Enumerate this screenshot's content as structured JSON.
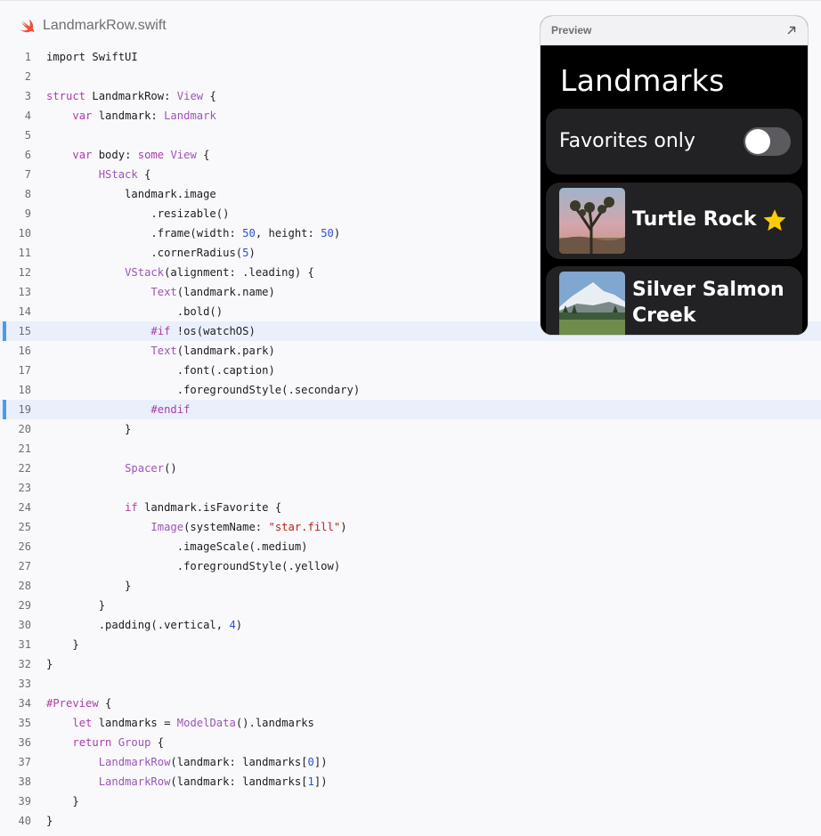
{
  "file": {
    "name": "LandmarkRow.swift",
    "icon": "swift-icon",
    "accent": "#f05138"
  },
  "preview": {
    "label": "Preview",
    "expand_icon": "expand-arrow-icon",
    "title": "Landmarks",
    "toggle_label": "Favorites only",
    "toggle_on": false,
    "rows": [
      {
        "name": "Turtle Rock",
        "favorite": true,
        "image": "joshua-tree-photo"
      },
      {
        "name": "Silver Salmon Creek",
        "name_lines": [
          "Silver Salmon",
          "Creek"
        ],
        "favorite": false,
        "image": "mountain-lake-photo"
      }
    ]
  },
  "highlighted_lines": [
    15,
    19
  ],
  "colors": {
    "highlight_bg": "#e9f0fb",
    "highlight_bar": "#4c9be8",
    "keyword": "#ad3da4",
    "type": "#9d54b8",
    "number": "#2a4fd6",
    "string": "#c41a16"
  },
  "code_lines": [
    [
      [
        "import SwiftUI",
        "p"
      ]
    ],
    [],
    [
      [
        "struct ",
        "k"
      ],
      [
        "LandmarkRow: ",
        "p"
      ],
      [
        "View",
        "t"
      ],
      [
        " {",
        "p"
      ]
    ],
    [
      [
        "    ",
        "p"
      ],
      [
        "var ",
        "k"
      ],
      [
        "landmark: ",
        "p"
      ],
      [
        "Landmark",
        "t"
      ]
    ],
    [],
    [
      [
        "    ",
        "p"
      ],
      [
        "var ",
        "k"
      ],
      [
        "body: ",
        "p"
      ],
      [
        "some ",
        "k"
      ],
      [
        "View",
        "t"
      ],
      [
        " {",
        "p"
      ]
    ],
    [
      [
        "        ",
        "p"
      ],
      [
        "HStack",
        "t"
      ],
      [
        " {",
        "p"
      ]
    ],
    [
      [
        "            landmark.image",
        "p"
      ]
    ],
    [
      [
        "                .resizable()",
        "p"
      ]
    ],
    [
      [
        "                .frame(width: ",
        "p"
      ],
      [
        "50",
        "n"
      ],
      [
        ", height: ",
        "p"
      ],
      [
        "50",
        "n"
      ],
      [
        ")",
        "p"
      ]
    ],
    [
      [
        "                .cornerRadius(",
        "p"
      ],
      [
        "5",
        "n"
      ],
      [
        ")",
        "p"
      ]
    ],
    [
      [
        "            ",
        "p"
      ],
      [
        "VStack",
        "t"
      ],
      [
        "(alignment: .leading) {",
        "p"
      ]
    ],
    [
      [
        "                ",
        "p"
      ],
      [
        "Text",
        "t"
      ],
      [
        "(landmark.name)",
        "p"
      ]
    ],
    [
      [
        "                    .bold()",
        "p"
      ]
    ],
    [
      [
        "                ",
        "p"
      ],
      [
        "#if",
        "k"
      ],
      [
        " !os(watchOS)",
        "p"
      ]
    ],
    [
      [
        "                ",
        "p"
      ],
      [
        "Text",
        "t"
      ],
      [
        "(landmark.park)",
        "p"
      ]
    ],
    [
      [
        "                    .font(.caption)",
        "p"
      ]
    ],
    [
      [
        "                    .foregroundStyle(.secondary)",
        "p"
      ]
    ],
    [
      [
        "                ",
        "p"
      ],
      [
        "#endif",
        "k"
      ]
    ],
    [
      [
        "            }",
        "p"
      ]
    ],
    [],
    [
      [
        "            ",
        "p"
      ],
      [
        "Spacer",
        "t"
      ],
      [
        "()",
        "p"
      ]
    ],
    [],
    [
      [
        "            ",
        "p"
      ],
      [
        "if ",
        "k"
      ],
      [
        "landmark.isFavorite {",
        "p"
      ]
    ],
    [
      [
        "                ",
        "p"
      ],
      [
        "Image",
        "t"
      ],
      [
        "(systemName: ",
        "p"
      ],
      [
        "\"star.fill\"",
        "s"
      ],
      [
        ")",
        "p"
      ]
    ],
    [
      [
        "                    .imageScale(.medium)",
        "p"
      ]
    ],
    [
      [
        "                    .foregroundStyle(.yellow)",
        "p"
      ]
    ],
    [
      [
        "            }",
        "p"
      ]
    ],
    [
      [
        "        }",
        "p"
      ]
    ],
    [
      [
        "        .padding(.vertical, ",
        "p"
      ],
      [
        "4",
        "n"
      ],
      [
        ")",
        "p"
      ]
    ],
    [
      [
        "    }",
        "p"
      ]
    ],
    [
      [
        "}",
        "p"
      ]
    ],
    [],
    [
      [
        "#Preview",
        "k"
      ],
      [
        " {",
        "p"
      ]
    ],
    [
      [
        "    ",
        "p"
      ],
      [
        "let ",
        "k"
      ],
      [
        "landmarks = ",
        "p"
      ],
      [
        "ModelData",
        "t"
      ],
      [
        "().landmarks",
        "p"
      ]
    ],
    [
      [
        "    ",
        "p"
      ],
      [
        "return ",
        "k"
      ],
      [
        "Group",
        "t"
      ],
      [
        " {",
        "p"
      ]
    ],
    [
      [
        "        ",
        "p"
      ],
      [
        "LandmarkRow",
        "t"
      ],
      [
        "(landmark: landmarks[",
        "p"
      ],
      [
        "0",
        "n"
      ],
      [
        "])",
        "p"
      ]
    ],
    [
      [
        "        ",
        "p"
      ],
      [
        "LandmarkRow",
        "t"
      ],
      [
        "(landmark: landmarks[",
        "p"
      ],
      [
        "1",
        "n"
      ],
      [
        "])",
        "p"
      ]
    ],
    [
      [
        "    }",
        "p"
      ]
    ],
    [
      [
        "}",
        "p"
      ]
    ]
  ]
}
